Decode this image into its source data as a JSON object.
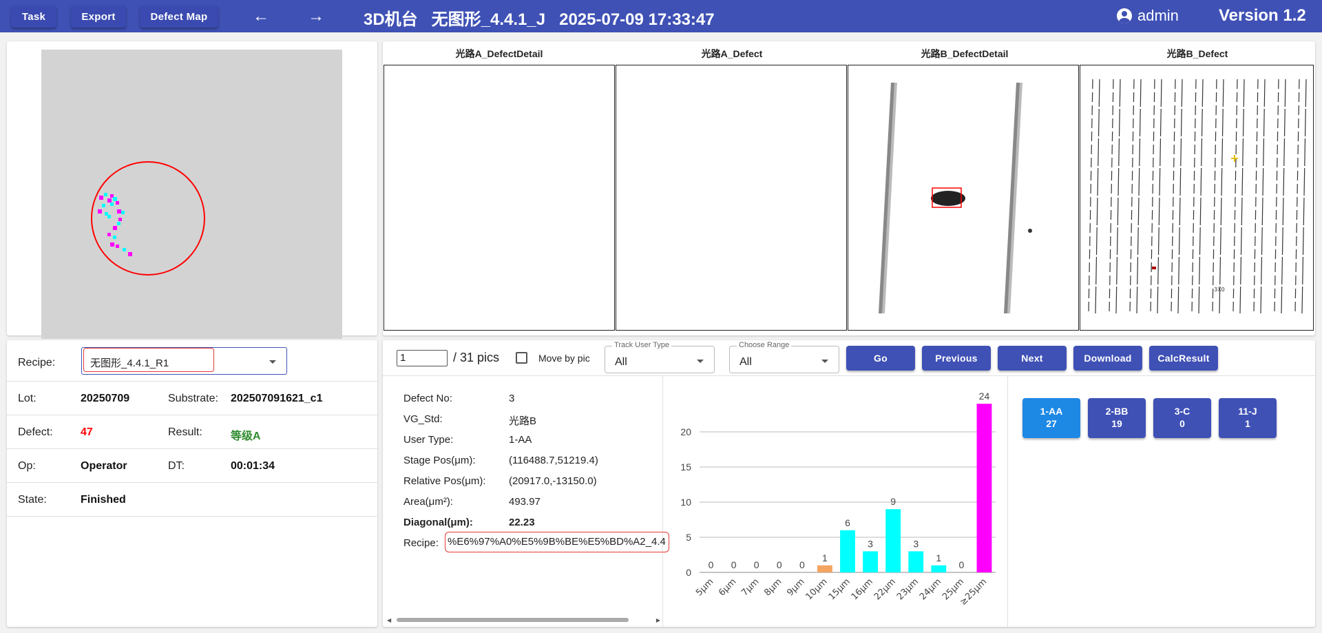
{
  "header": {
    "buttons": [
      "Task",
      "Export",
      "Defect Map"
    ],
    "title": "3D机台   无图形_4.4.1_J   2025-07-09 17:33:47",
    "user": "admin",
    "version": "Version 1.2"
  },
  "info": {
    "recipe_label": "Recipe:",
    "recipe_value": "无图形_4.4.1_R1",
    "lot_label": "Lot:",
    "lot_value": "20250709",
    "substrate_label": "Substrate:",
    "substrate_value": "202507091621_c1",
    "defect_label": "Defect:",
    "defect_value": "47",
    "result_label": "Result:",
    "result_value": "等级A",
    "op_label": "Op:",
    "op_value": "Operator",
    "dt_label": "DT:",
    "dt_value": "00:01:34",
    "state_label": "State:",
    "state_value": "Finished"
  },
  "images": {
    "titles": [
      "光路A_DefectDetail",
      "光路A_Defect",
      "光路B_DefectDetail",
      "光路B_Defect"
    ],
    "label_3x": "3X0"
  },
  "controls": {
    "page_value": "1",
    "page_total": "/ 31 pics",
    "move_by_pic": "Move by pic",
    "track_user_type_label": "Track User Type",
    "track_user_type_value": "All",
    "choose_range_label": "Choose Range",
    "choose_range_value": "All",
    "buttons": [
      "Go",
      "Previous",
      "Next",
      "Download",
      "CalcResult"
    ]
  },
  "detail": {
    "defect_no_label": "Defect No:",
    "defect_no_value": "3",
    "vg_std_label": "VG_Std:",
    "vg_std_value": "光路B",
    "user_type_label": "User Type:",
    "user_type_value": "1-AA",
    "stage_pos_label": "Stage Pos(μm):",
    "stage_pos_value": "(116488.7,51219.4)",
    "relative_pos_label": "Relative Pos(μm):",
    "relative_pos_value": "(20917.0,-13150.0)",
    "area_label": "Area(μm²):",
    "area_value": "493.97",
    "diagonal_label": "Diagonal(μm):",
    "diagonal_value": "22.23",
    "recipe_label": "Recipe:",
    "recipe_value": "%E6%97%A0%E5%9B%BE%E5%BD%A2_4.4"
  },
  "chart_data": {
    "type": "bar",
    "categories": [
      "5μm",
      "6μm",
      "7μm",
      "8μm",
      "9μm",
      "10μm",
      "15μm",
      "16μm",
      "22μm",
      "23μm",
      "24μm",
      "25μm",
      "≥25μm"
    ],
    "values": [
      0,
      0,
      0,
      0,
      0,
      1,
      6,
      3,
      9,
      3,
      1,
      0,
      24
    ],
    "colors": [
      "#00ffff",
      "#00ffff",
      "#00ffff",
      "#00ffff",
      "#00ffff",
      "#f4a460",
      "#00ffff",
      "#00ffff",
      "#00ffff",
      "#00ffff",
      "#00ffff",
      "#00ffff",
      "#ff00ff"
    ],
    "yticks": [
      0,
      5,
      10,
      15,
      20
    ],
    "ylim": [
      0,
      25
    ],
    "grid": true
  },
  "type_buttons": [
    {
      "name": "1-AA",
      "count": "27",
      "active": true
    },
    {
      "name": "2-BB",
      "count": "19",
      "active": false
    },
    {
      "name": "3-C",
      "count": "0",
      "active": false
    },
    {
      "name": "11-J",
      "count": "1",
      "active": false
    }
  ],
  "colors": {
    "primary": "#3f51b5",
    "active": "#1e88e5",
    "defect_red": "#ff0000",
    "result_green": "#2e8b2e",
    "highlight_border": "#e53935"
  }
}
